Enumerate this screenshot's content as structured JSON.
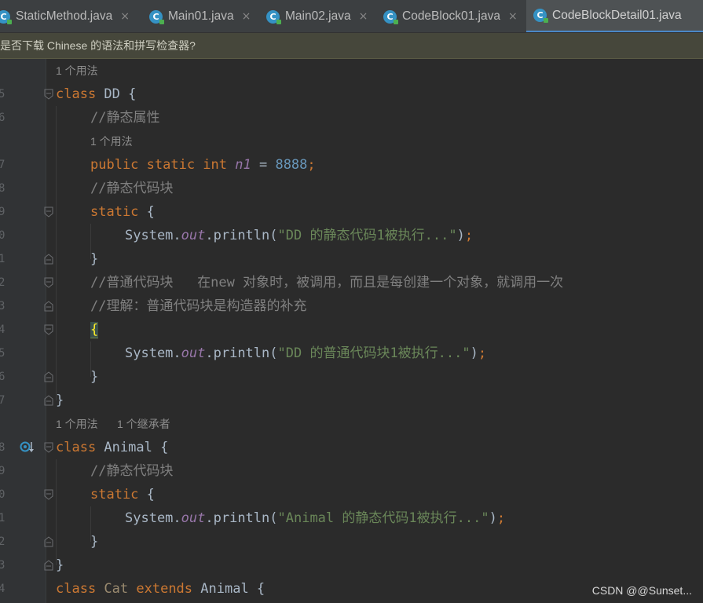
{
  "tabs": [
    {
      "label": "StaticMethod.java",
      "active": false
    },
    {
      "label": "Main01.java",
      "active": false
    },
    {
      "label": "Main02.java",
      "active": false
    },
    {
      "label": "CodeBlock01.java",
      "active": false
    },
    {
      "label": "CodeBlockDetail01.java",
      "active": true
    }
  ],
  "tab_close_glyph": "×",
  "file_icon_letter": "C",
  "notification": "是否下载 Chinese 的语法和拼写检查器?",
  "hints": {
    "h1": "1 个用法",
    "h2": "1 个用法",
    "h3a": "1 个用法",
    "h3b": "1 个继承者"
  },
  "line_numbers": [
    "5",
    "6",
    "7",
    "8",
    "9",
    "0",
    "1",
    "2",
    "3",
    "4",
    "5",
    "6",
    "7",
    "8",
    "9",
    "0",
    "1",
    "2",
    "3",
    "4"
  ],
  "code": {
    "l1_kw": "class",
    "l1_rest": " DD {",
    "l2": "//静态属性",
    "l3_kw": "public static int",
    "l3_sp": " ",
    "l3_fld": "n1",
    "l3_eq": " = ",
    "l3_num": "8888",
    "l3_semi": ";",
    "l4": "//静态代码块",
    "l5_kw": "static",
    "l5_rest": " {",
    "l6_a": "System.",
    "l6_fld": "out",
    "l6_b": ".println(",
    "l6_str": "\"DD 的静态代码1被执行...\"",
    "l6_c": ")",
    "l6_semi": ";",
    "l7": "}",
    "l8": "//普通代码块   在new 对象时，被调用，而且是每创建一个对象，就调用一次",
    "l9": "//理解：普通代码块是构造器的补充",
    "l10": "{",
    "l11_a": "System.",
    "l11_fld": "out",
    "l11_b": ".println(",
    "l11_str": "\"DD 的普通代码块1被执行...\"",
    "l11_c": ")",
    "l11_semi": ";",
    "l12": "}",
    "l13": "}",
    "l14_kw": "class",
    "l14_rest": " Animal {",
    "l15": "//静态代码块",
    "l16_kw": "static",
    "l16_rest": " {",
    "l17_a": "System.",
    "l17_fld": "out",
    "l17_b": ".println(",
    "l17_str": "\"Animal 的静态代码1被执行...\"",
    "l17_c": ")",
    "l17_semi": ";",
    "l18": "}",
    "l19": "}",
    "l20_kw": "class",
    "l20_name": " Cat ",
    "l20_kw2": "extends",
    "l20_rest": " Animal {"
  },
  "watermark": "CSDN @@Sunset...",
  "colors": {
    "keyword": "#cc7832",
    "comment": "#808080",
    "string": "#6a8759",
    "number": "#6897bb",
    "field": "#9876aa",
    "text": "#a9b7c6",
    "background": "#2b2b2b",
    "active_tab_underline": "#4a88c7"
  },
  "icons": [
    "java-class-icon",
    "close-icon",
    "fold-icon",
    "overridden-method-gutter-icon"
  ]
}
